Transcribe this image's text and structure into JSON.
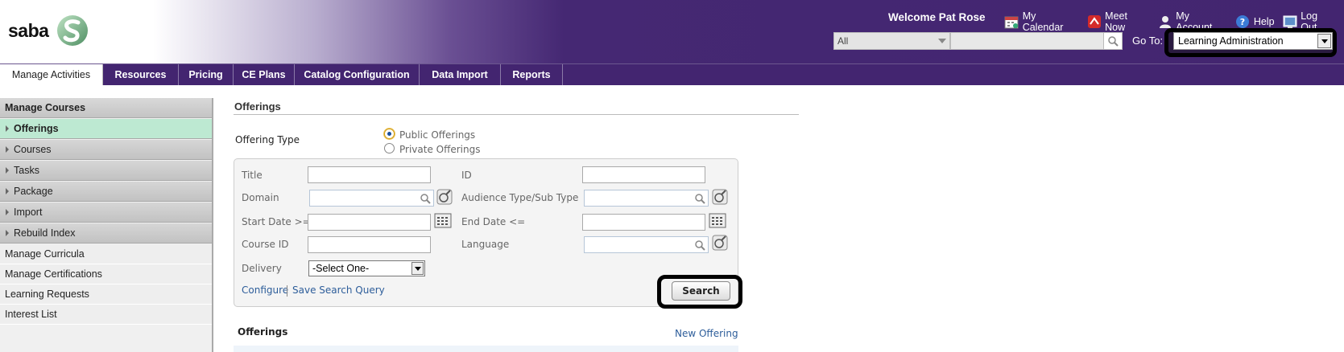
{
  "header": {
    "logo_text": "saba",
    "welcome": "Welcome Pat Rose",
    "links": [
      {
        "label": "My Calendar",
        "icon": "calendar-icon"
      },
      {
        "label": "Meet Now",
        "icon": "meet-now-icon"
      },
      {
        "label": "My Account",
        "icon": "user-icon"
      },
      {
        "label": "Help",
        "icon": "help-icon"
      },
      {
        "label": "Log Out",
        "icon": "logout-icon"
      }
    ],
    "search_scope": "All",
    "search_value": "",
    "goto_label": "Go To:",
    "goto_value": "Learning Administration"
  },
  "nav": {
    "tabs": [
      {
        "label": "Manage Activities",
        "active": true
      },
      {
        "label": "Resources"
      },
      {
        "label": "Pricing"
      },
      {
        "label": "CE Plans"
      },
      {
        "label": "Catalog Configuration"
      },
      {
        "label": "Data Import"
      },
      {
        "label": "Reports"
      }
    ]
  },
  "sidebar": {
    "header": "Manage Courses",
    "sub_items": [
      "Offerings",
      "Courses",
      "Tasks",
      "Package",
      "Import",
      "Rebuild Index"
    ],
    "selected": "Offerings",
    "plain_items": [
      "Manage Curricula",
      "Manage Certifications",
      "Learning Requests",
      "Interest List"
    ]
  },
  "main": {
    "title": "Offerings",
    "offering_type_label": "Offering Type",
    "public_label": "Public Offerings",
    "private_label": "Private Offerings",
    "selected_type": "Public Offerings",
    "form": {
      "title_label": "Title",
      "id_label": "ID",
      "domain_label": "Domain",
      "audience_label": "Audience Type/Sub Type",
      "start_date_label": "Start Date >=",
      "end_date_label": "End Date <=",
      "course_id_label": "Course ID",
      "language_label": "Language",
      "delivery_label": "Delivery",
      "delivery_value": "-Select One-",
      "configure_link": "Configure",
      "save_query_link": "Save Search Query",
      "search_button": "Search"
    },
    "offerings_section_label": "Offerings",
    "new_offering_link": "New Offering"
  },
  "colors": {
    "header_purple": "#432570",
    "selected_green": "#bde9d2",
    "link_blue": "#2d5d9a"
  }
}
